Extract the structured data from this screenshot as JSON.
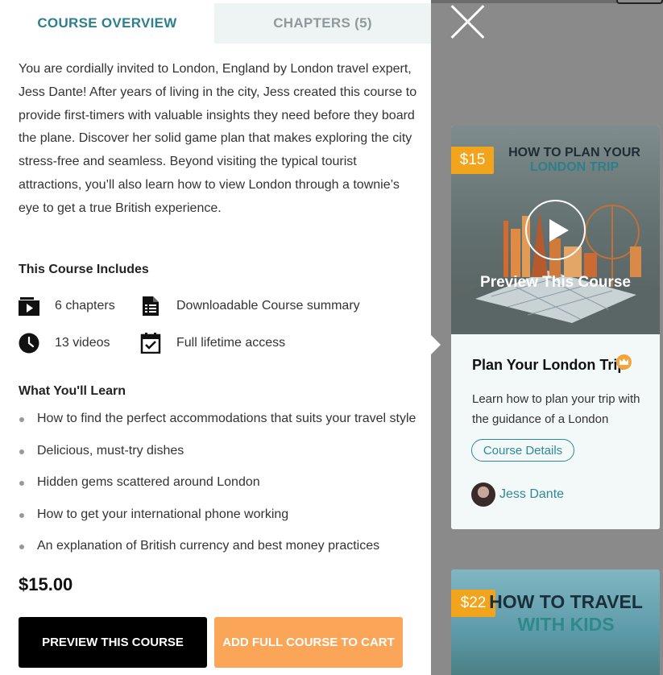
{
  "tabs": {
    "overview": "COURSE OVERVIEW",
    "chapters": "CHAPTERS (5)"
  },
  "description": "You are cordially invited to London, England by London travel expert, Jess Dante! After years of living in the city, Jess created this course to provide first-timers with valuable insights they need before they board the plane. Discover her solid game plan that makes exploring the city stress-free and seamless. Beyond visiting the typical tourist attractions, you’ll also learn how to view London through a townie’s eye to get a true British experience.",
  "includes": {
    "title": "This Course Includes",
    "chapters": "6 chapters",
    "summary": "Downloadable Course summary",
    "videos": "13 videos",
    "access": "Full lifetime access"
  },
  "learn": {
    "title": "What You'll Learn",
    "items": [
      "How to find the perfect accommodations that suits your travel style",
      "Delicious, must-try dishes",
      "Hidden gems scattered around London",
      "How to get your international phone working",
      "An explanation of British currency and best money practices"
    ]
  },
  "price": "$15.00",
  "buttons": {
    "preview": "PREVIEW THIS COURSE",
    "cart": "ADD FULL COURSE TO CART"
  },
  "card": {
    "price_badge": "$15",
    "thumb_title_1": "HOW TO PLAN YOUR",
    "thumb_title_2": "LONDON TRIP",
    "preview_label": "Preview This Course",
    "title": "Plan Your London Trip",
    "description": "Learn how to plan your trip with the guidance of a London",
    "details_button": "Course Details",
    "author": "Jess Dante"
  },
  "card2": {
    "price_badge": "$22",
    "title_1": "HOW TO TRAVEL",
    "title_2": "WITH KIDS"
  },
  "colors": {
    "accent": "#2d7f8e",
    "orange_button": "#fba558",
    "badge": "#f2a41c"
  },
  "icons": [
    "close-icon",
    "video-chapter-icon",
    "document-list-icon",
    "clock-icon",
    "calendar-check-icon",
    "play-icon",
    "crown-icon"
  ]
}
